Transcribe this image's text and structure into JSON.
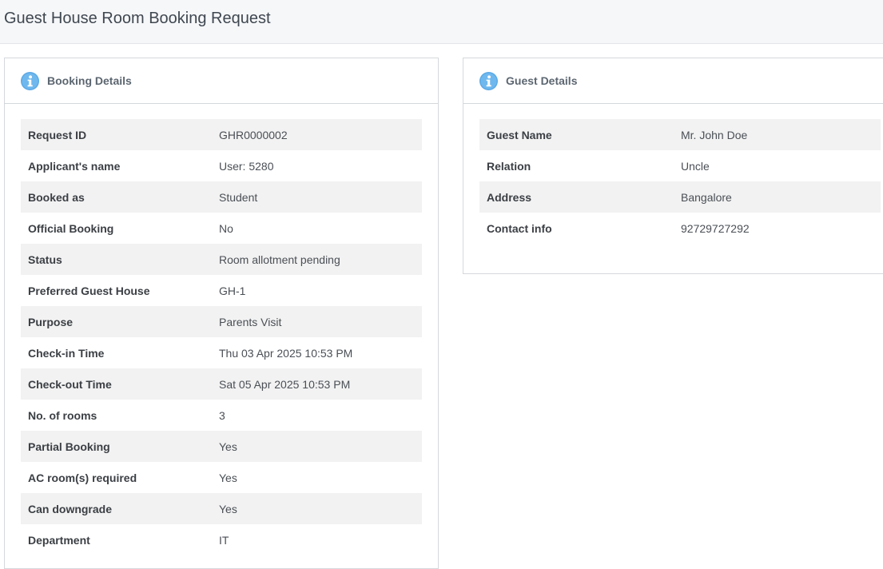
{
  "page": {
    "title": "Guest House Room Booking Request"
  },
  "colors": {
    "info_icon": "#5aa9e6",
    "header_bg": "#f6f7f9",
    "row_stripe": "#f2f2f2"
  },
  "booking_details": {
    "title": "Booking Details",
    "icon": "info-icon",
    "rows": [
      {
        "label": "Request ID",
        "value": "GHR0000002"
      },
      {
        "label": "Applicant's name",
        "value": "User: 5280"
      },
      {
        "label": "Booked as",
        "value": "Student"
      },
      {
        "label": "Official Booking",
        "value": "No"
      },
      {
        "label": "Status",
        "value": "Room allotment pending"
      },
      {
        "label": "Preferred Guest House",
        "value": "GH-1"
      },
      {
        "label": "Purpose",
        "value": "Parents Visit"
      },
      {
        "label": "Check-in Time",
        "value": "Thu 03 Apr 2025 10:53 PM"
      },
      {
        "label": "Check-out Time",
        "value": "Sat 05 Apr 2025 10:53 PM"
      },
      {
        "label": "No. of rooms",
        "value": "3"
      },
      {
        "label": "Partial Booking",
        "value": "Yes"
      },
      {
        "label": "AC room(s) required",
        "value": "Yes"
      },
      {
        "label": "Can downgrade",
        "value": "Yes"
      },
      {
        "label": "Department",
        "value": "IT"
      }
    ]
  },
  "guest_details": {
    "title": "Guest Details",
    "icon": "info-icon",
    "rows": [
      {
        "label": "Guest Name",
        "value": "Mr. John Doe"
      },
      {
        "label": "Relation",
        "value": "Uncle"
      },
      {
        "label": "Address",
        "value": "Bangalore"
      },
      {
        "label": "Contact info",
        "value": "92729727292"
      }
    ]
  }
}
